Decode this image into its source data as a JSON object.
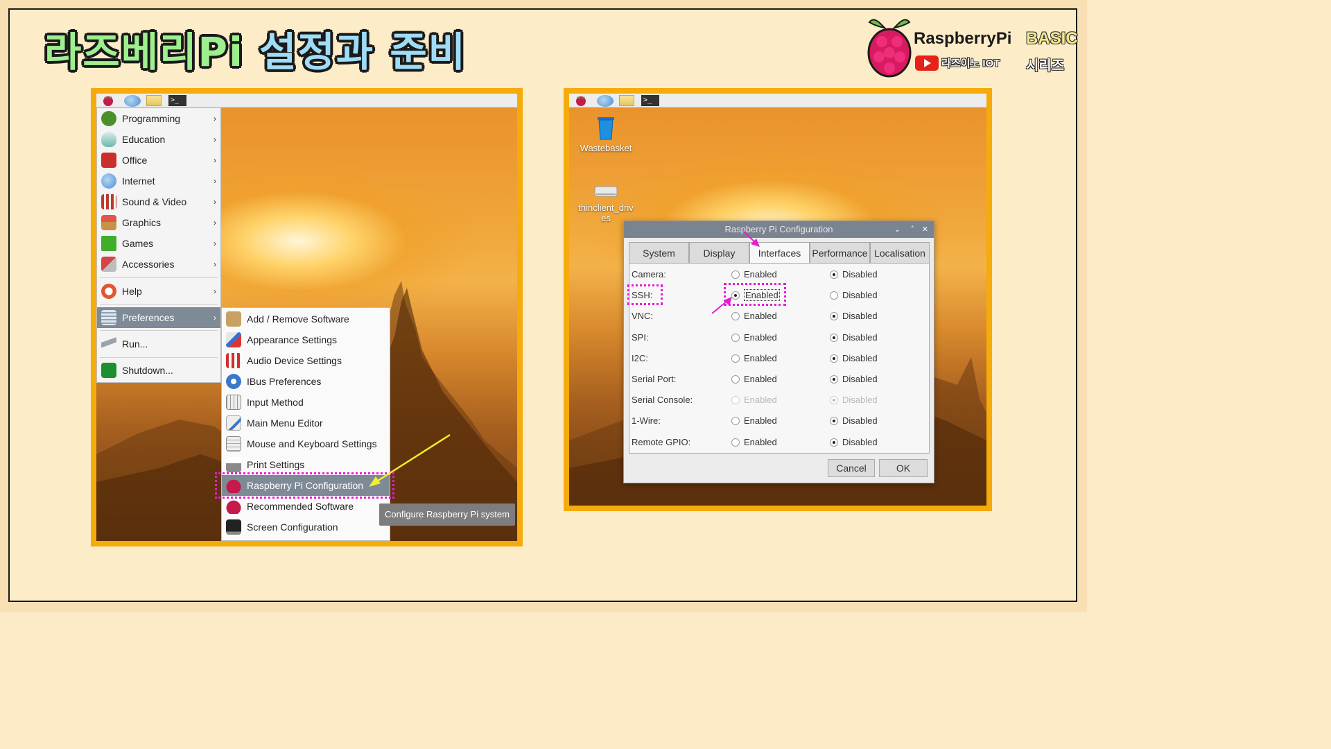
{
  "slide": {
    "title_part1": "라즈베리Pi",
    "title_part2": "설정과 준비",
    "logo": {
      "brand": "RaspberryPi",
      "basic": "BASIC",
      "channel": "라즈이노 IOT",
      "series": "시리즈"
    }
  },
  "colors": {
    "frame": "#f5ab0c",
    "highlight": "#e81ad6",
    "arrow_yellow": "#f3f02a",
    "menu_selected": "#7f8a97"
  },
  "left_screen": {
    "taskbar": {
      "icons": [
        "raspberry-icon",
        "globe-icon",
        "folder-icon",
        "terminal-icon"
      ],
      "terminal_glyph": ">_"
    },
    "main_menu": [
      {
        "label": "Programming",
        "icon": "programming-icon"
      },
      {
        "label": "Education",
        "icon": "education-icon"
      },
      {
        "label": "Office",
        "icon": "office-icon"
      },
      {
        "label": "Internet",
        "icon": "internet-icon"
      },
      {
        "label": "Sound & Video",
        "icon": "sound-video-icon"
      },
      {
        "label": "Graphics",
        "icon": "graphics-icon"
      },
      {
        "label": "Games",
        "icon": "games-icon"
      },
      {
        "label": "Accessories",
        "icon": "accessories-icon"
      },
      {
        "label": "Help",
        "icon": "help-icon"
      },
      {
        "label": "Preferences",
        "icon": "preferences-icon"
      },
      {
        "label": "Run...",
        "icon": "run-icon"
      },
      {
        "label": "Shutdown...",
        "icon": "shutdown-icon"
      }
    ],
    "submenu": [
      {
        "label": "Add / Remove Software"
      },
      {
        "label": "Appearance Settings"
      },
      {
        "label": "Audio Device Settings"
      },
      {
        "label": "IBus Preferences"
      },
      {
        "label": "Input Method"
      },
      {
        "label": "Main Menu Editor"
      },
      {
        "label": "Mouse and Keyboard Settings"
      },
      {
        "label": "Print Settings"
      },
      {
        "label": "Raspberry Pi Configuration"
      },
      {
        "label": "Recommended Software"
      },
      {
        "label": "Screen Configuration"
      }
    ],
    "tooltip": "Configure Raspberry Pi system"
  },
  "right_screen": {
    "desktop_icons": [
      {
        "label": "Wastebasket"
      },
      {
        "label": "thinclient_drives"
      }
    ],
    "dialog": {
      "title": "Raspberry Pi Configuration",
      "tabs": [
        "System",
        "Display",
        "Interfaces",
        "Performance",
        "Localisation"
      ],
      "active_tab": "Interfaces",
      "enabled_label": "Enabled",
      "disabled_label": "Disabled",
      "rows": [
        {
          "label": "Camera:",
          "value": "Disabled"
        },
        {
          "label": "SSH:",
          "value": "Enabled"
        },
        {
          "label": "VNC:",
          "value": "Disabled"
        },
        {
          "label": "SPI:",
          "value": "Disabled"
        },
        {
          "label": "I2C:",
          "value": "Disabled"
        },
        {
          "label": "Serial Port:",
          "value": "Disabled"
        },
        {
          "label": "Serial Console:",
          "value": "Disabled"
        },
        {
          "label": "1-Wire:",
          "value": "Disabled"
        },
        {
          "label": "Remote GPIO:",
          "value": "Disabled"
        }
      ],
      "cancel_label": "Cancel",
      "ok_label": "OK"
    }
  }
}
